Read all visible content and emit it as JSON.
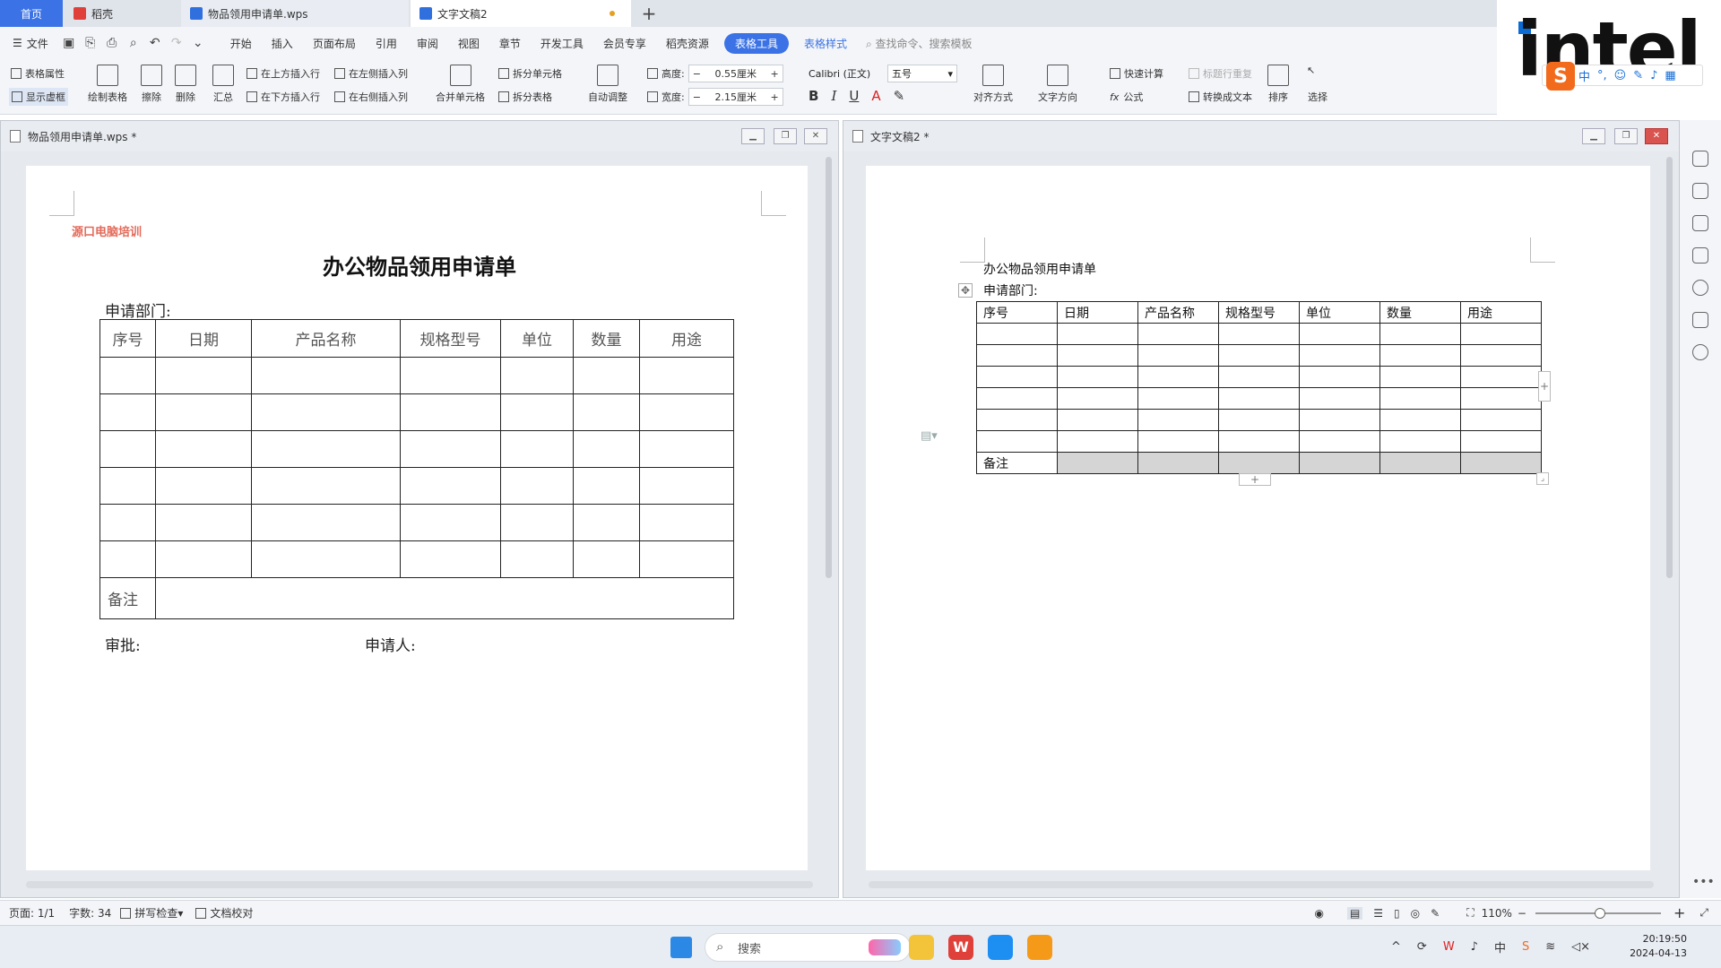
{
  "tabs": {
    "home": "首页",
    "tab1": "稻壳",
    "tab2": "物品领用申请单.wps",
    "tab3": "文字文稿2"
  },
  "menu": {
    "file": "文件",
    "items": [
      "开始",
      "插入",
      "页面布局",
      "引用",
      "审阅",
      "视图",
      "章节",
      "开发工具",
      "会员专享",
      "稻壳资源"
    ],
    "table_tools": "表格工具",
    "table_style": "表格样式",
    "search_placeholder": "查找命令、搜索模板"
  },
  "toolbar": {
    "table_props": "表格属性",
    "show_grid": "显示虚框",
    "draw_table": "绘制表格",
    "erase": "擦除",
    "delete": "删除",
    "summary": "汇总",
    "insert_above": "在上方插入行",
    "insert_below": "在下方插入行",
    "insert_left": "在左侧插入列",
    "insert_right": "在右侧插入列",
    "merge_cells": "合并单元格",
    "split_cells": "拆分单元格",
    "split_table": "拆分表格",
    "auto_fit": "自动调整",
    "height_label": "高度:",
    "height_value": "0.55厘米",
    "width_label": "宽度:",
    "width_value": "2.15厘米",
    "font_name": "Calibri (正文)",
    "font_size": "五号",
    "align": "对齐方式",
    "text_dir": "文字方向",
    "quick_calc": "快速计算",
    "repeat_header": "标题行重复",
    "formula": "公式",
    "convert_text": "转换成文本",
    "sort": "排序",
    "select": "选择"
  },
  "logo": {
    "text": "intel"
  },
  "ime": {
    "mode": "中"
  },
  "left_pane": {
    "title": "物品领用申请单.wps *",
    "brand": "源口电脑培训",
    "doc_title": "办公物品领用申请单",
    "dept": "申请部门:",
    "headers": [
      "序号",
      "日期",
      "产品名称",
      "规格型号",
      "单位",
      "数量",
      "用途"
    ],
    "note": "备注",
    "approve": "审批:",
    "applicant": "申请人:"
  },
  "right_pane": {
    "title": "文字文稿2 *",
    "doc_title": "办公物品领用申请单",
    "dept": "申请部门:",
    "headers": [
      "序号",
      "日期",
      "产品名称",
      "规格型号",
      "单位",
      "数量",
      "用途"
    ],
    "note": "备注"
  },
  "status": {
    "page": "页面: 1/1",
    "words": "字数: 34",
    "spell": "拼写检查",
    "proof": "文档校对",
    "zoom": "110%"
  },
  "taskbar": {
    "search": "搜索",
    "time": "20:19:50",
    "date": "2024-04-13"
  },
  "colors": {
    "accent": "#3b73e6",
    "brand_red": "#e36a5a",
    "note_shade": "#d5d5d5"
  }
}
